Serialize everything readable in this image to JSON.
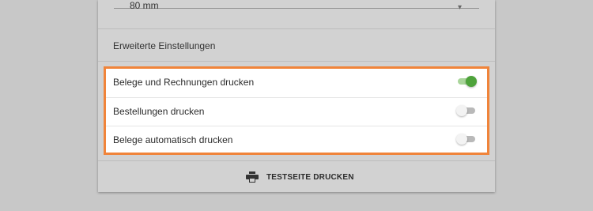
{
  "top_select": {
    "value": "80 mm"
  },
  "section": {
    "title": "Erweiterte Einstellungen"
  },
  "settings": [
    {
      "label": "Belege und Rechnungen drucken",
      "enabled": true
    },
    {
      "label": "Bestellungen drucken",
      "enabled": false
    },
    {
      "label": "Belege automatisch drucken",
      "enabled": false
    }
  ],
  "footer": {
    "print_label": "TESTSEITE DRUCKEN",
    "icon": "printer-icon"
  },
  "colors": {
    "highlight": "#f0843a",
    "toggle_on": "#4ea33b",
    "toggle_off": "#b9b9b9"
  }
}
